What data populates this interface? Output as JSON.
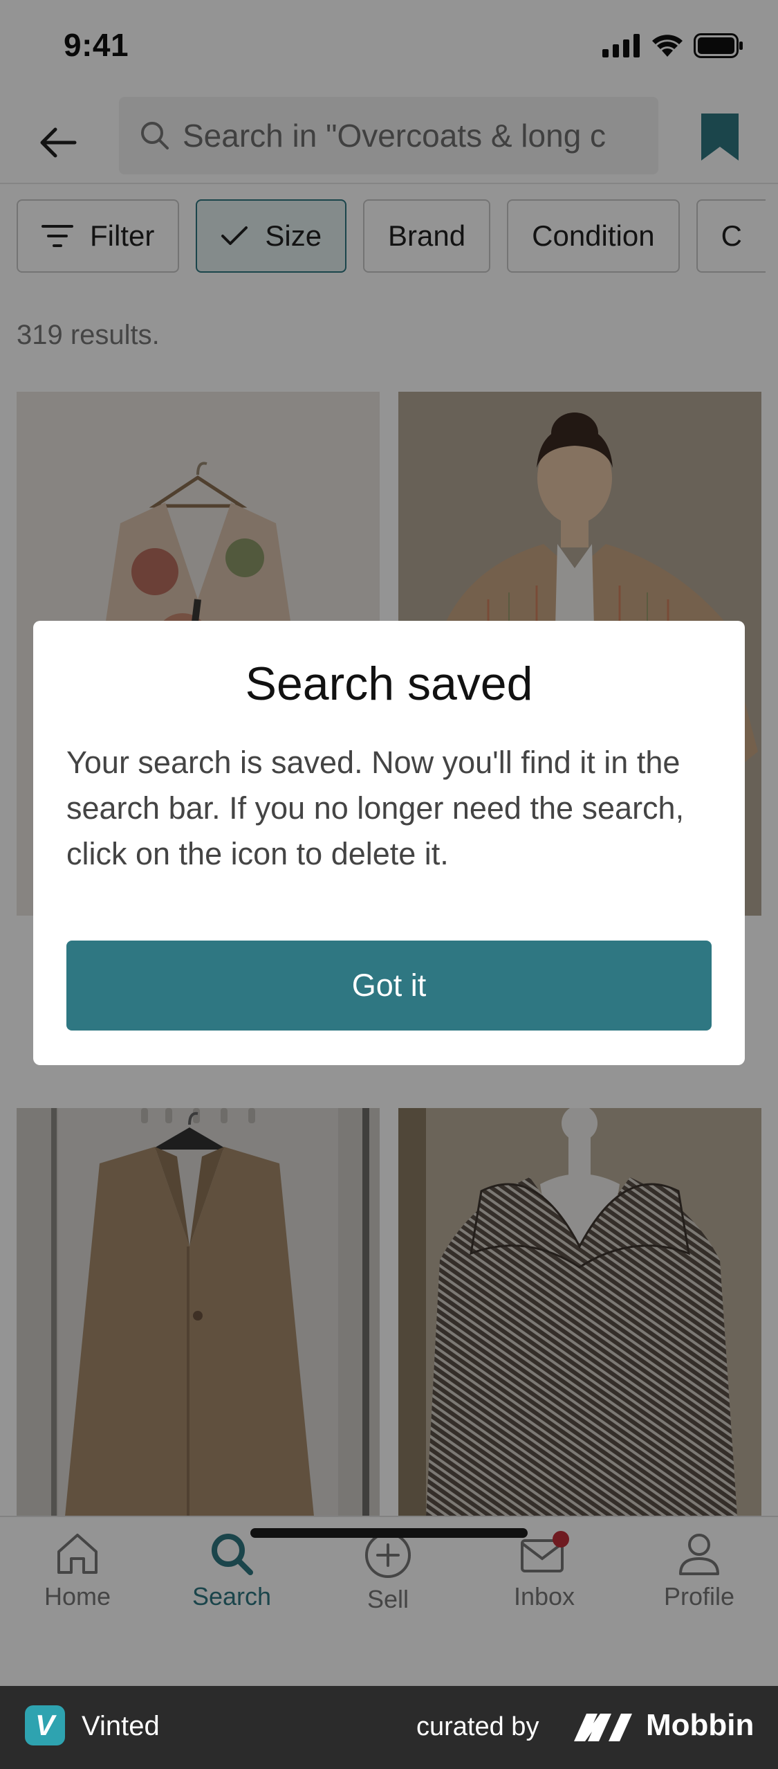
{
  "status": {
    "time": "9:41"
  },
  "search": {
    "placeholder": "Search in \"Overcoats & long c"
  },
  "chips": [
    {
      "label": "Filter"
    },
    {
      "label": "Size"
    },
    {
      "label": "Brand"
    },
    {
      "label": "Condition"
    },
    {
      "label": "C"
    }
  ],
  "results": {
    "count_text": "319 results."
  },
  "modal": {
    "title": "Search saved",
    "body": "Your search is saved. Now you'll find it in the search bar. If you no longer need the search, click on the icon to delete it.",
    "button": "Got it"
  },
  "nav": {
    "home": "Home",
    "search": "Search",
    "sell": "Sell",
    "inbox": "Inbox",
    "profile": "Profile"
  },
  "credit": {
    "app_name": "Vinted",
    "logo_letter": "V",
    "curated_by": "curated by",
    "brand": "Mobbin"
  },
  "colors": {
    "accent": "#2f7782",
    "badge": "#c0303a"
  }
}
